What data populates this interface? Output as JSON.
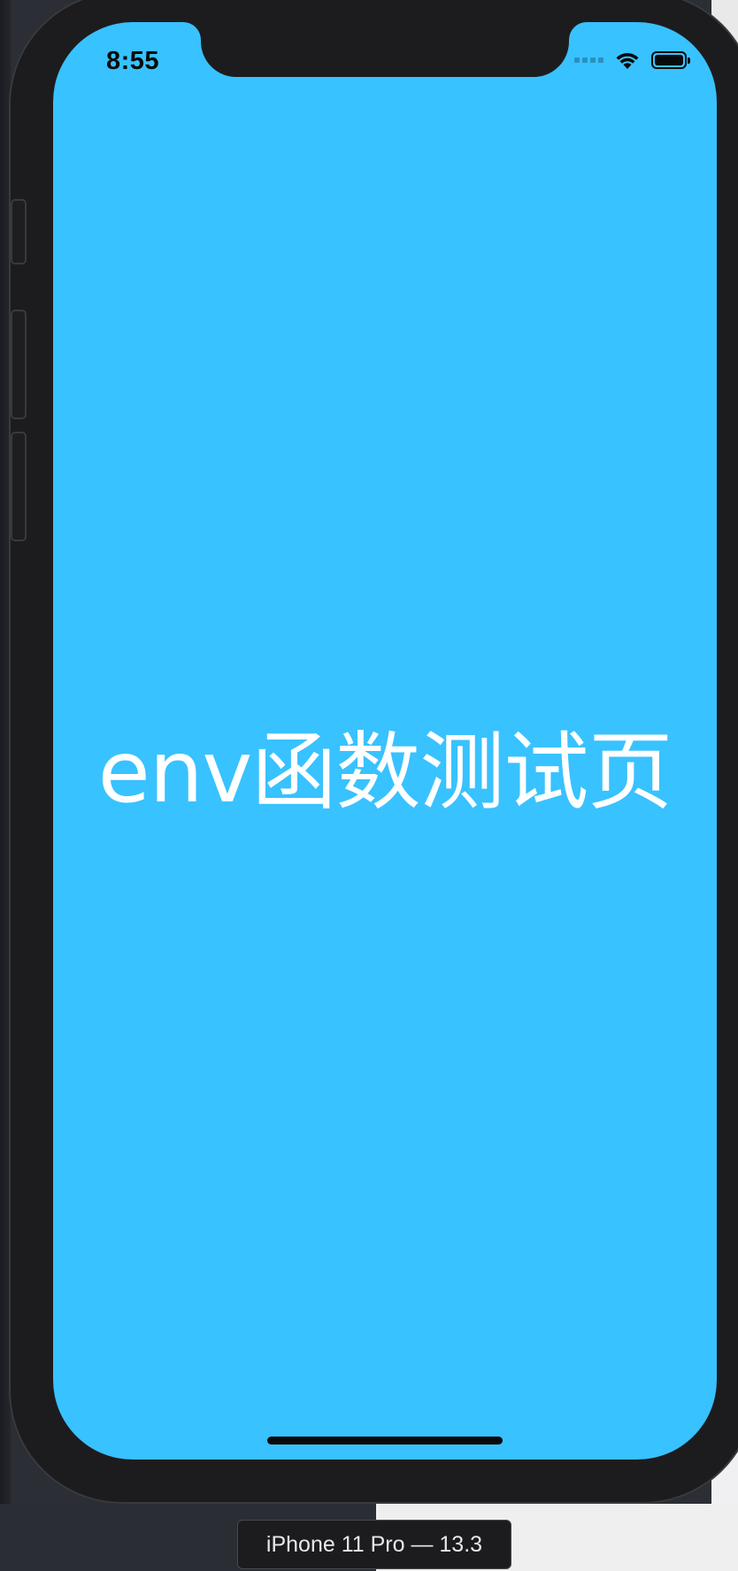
{
  "status_bar": {
    "time": "8:55",
    "icons": [
      "cellular-signal-icon",
      "wifi-icon",
      "battery-icon"
    ]
  },
  "screen": {
    "background_color": "#38c2ff",
    "title": "env函数测试页"
  },
  "simulator": {
    "device_label": "iPhone 11 Pro — 13.3"
  }
}
